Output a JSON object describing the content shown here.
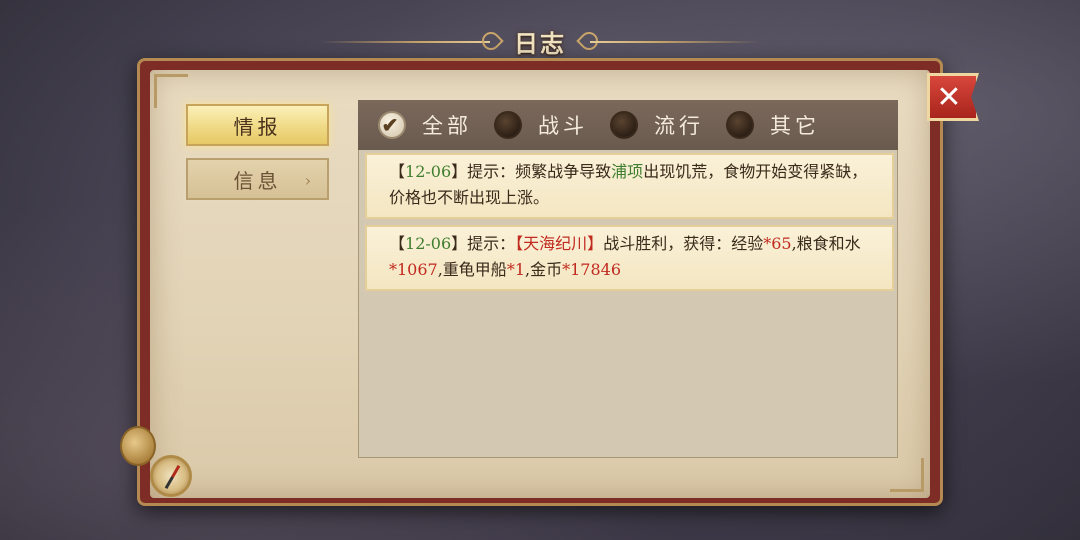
{
  "title": "日志",
  "tabs": [
    {
      "label": "情报",
      "active": true
    },
    {
      "label": "信息",
      "active": false,
      "arrow": "›"
    }
  ],
  "filters": [
    {
      "label": "全部",
      "checked": true
    },
    {
      "label": "战斗",
      "checked": false
    },
    {
      "label": "流行",
      "checked": false
    },
    {
      "label": "其它",
      "checked": false
    }
  ],
  "logs": [
    {
      "open_bracket": "【",
      "date": "12-06",
      "close_bracket": "】",
      "prefix": "提示：频繁战争导致",
      "place": "浦项",
      "message": "出现饥荒，食物开始变得紧缺，价格也不断出现上涨。"
    },
    {
      "open_bracket": "【",
      "date": "12-06",
      "close_bracket": "】",
      "prefix": "提示：",
      "target": "【天海纪川】",
      "text_a": "战斗胜利，获得：经验",
      "val_exp": "*65",
      "text_b": ",粮食和水",
      "val_food": "*1067",
      "text_c": ",重龟甲船",
      "val_ship": "*1",
      "text_d": ",金币",
      "val_gold": "*17846"
    }
  ],
  "close": {
    "icon": "close-x-icon",
    "glyph": "✕"
  },
  "colors": {
    "highlight_green": "#3f7e2e",
    "highlight_red": "#c12a1f",
    "book_red": "#7d2c26"
  }
}
